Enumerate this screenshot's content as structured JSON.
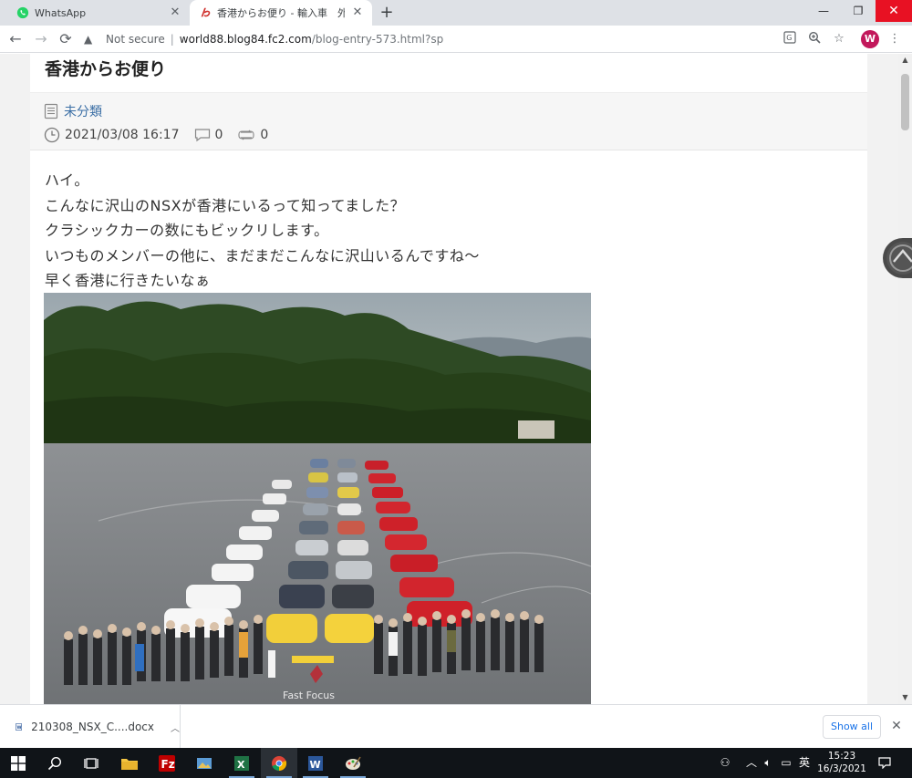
{
  "browser": {
    "tabs": [
      {
        "title": "WhatsApp",
        "active": false
      },
      {
        "title": "香港からお便り - 輸入車　外車",
        "active": true
      }
    ],
    "address": {
      "security_label": "Not secure",
      "host": "world88.blog84.fc2.com",
      "path": "/blog-entry-573.html?sp"
    },
    "profile_initial": "W"
  },
  "post": {
    "title": "香港からお便り",
    "category": "未分類",
    "datetime": "2021/03/08 16:17",
    "comment_count": "0",
    "trackback_count": "0",
    "lines": [
      "ハイ。",
      "こんなに沢山のNSXが香港にいるって知ってました？",
      "クラシックカーの数にもビックリします。",
      "いつものメンバーの他に、まだまだこんなに沢山いるんですね〜",
      "早く香港に行きたいなぁ"
    ],
    "photo_caption": "Fast Focus"
  },
  "downloads": {
    "file_name": "210308_NSX_C....docx",
    "show_all_label": "Show all"
  },
  "taskbar": {
    "time": "15:23",
    "date": "16/3/2021",
    "ime_label": "英"
  },
  "colors": {
    "tab_strip": "#dee1e6",
    "link": "#3a6ea5",
    "close_red": "#e81123",
    "avatar": "#c2185b",
    "taskbar": "#101418"
  }
}
